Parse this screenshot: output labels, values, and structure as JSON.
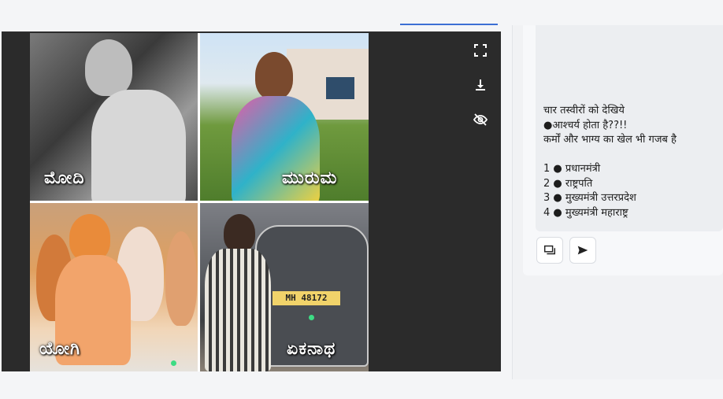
{
  "viewer": {
    "close_glyph": "×",
    "tools": [
      "fullscreen-icon",
      "download-icon",
      "hide-icon"
    ]
  },
  "collage": {
    "captions": [
      "ಮೋದಿ",
      "ಮುರುಮ",
      "ಯೋಗಿ",
      "ಏಕನಾಥ"
    ],
    "plate_text": "MH 48172"
  },
  "post": {
    "lines_1": [
      "चार तस्वीरों को देखिये",
      "●आश्चर्य होता है??!!",
      "कर्मों और भाग्य का खेल भी गजब है"
    ],
    "lines_2": [
      "1 ● प्रधानमंत्री",
      "2 ● राष्ट्रपति",
      "3 ● मुख्यमंत्री उत्तरप्रदेश",
      "4 ● मुख्यमंत्री महाराष्ट्र"
    ]
  },
  "actions": {
    "comment_icon": "comment-icon",
    "share_icon": "send-icon"
  },
  "colors": {
    "viewer_bg": "#2b2b2b",
    "accent": "#3b6fd4",
    "indicator": "#3ddc84"
  }
}
